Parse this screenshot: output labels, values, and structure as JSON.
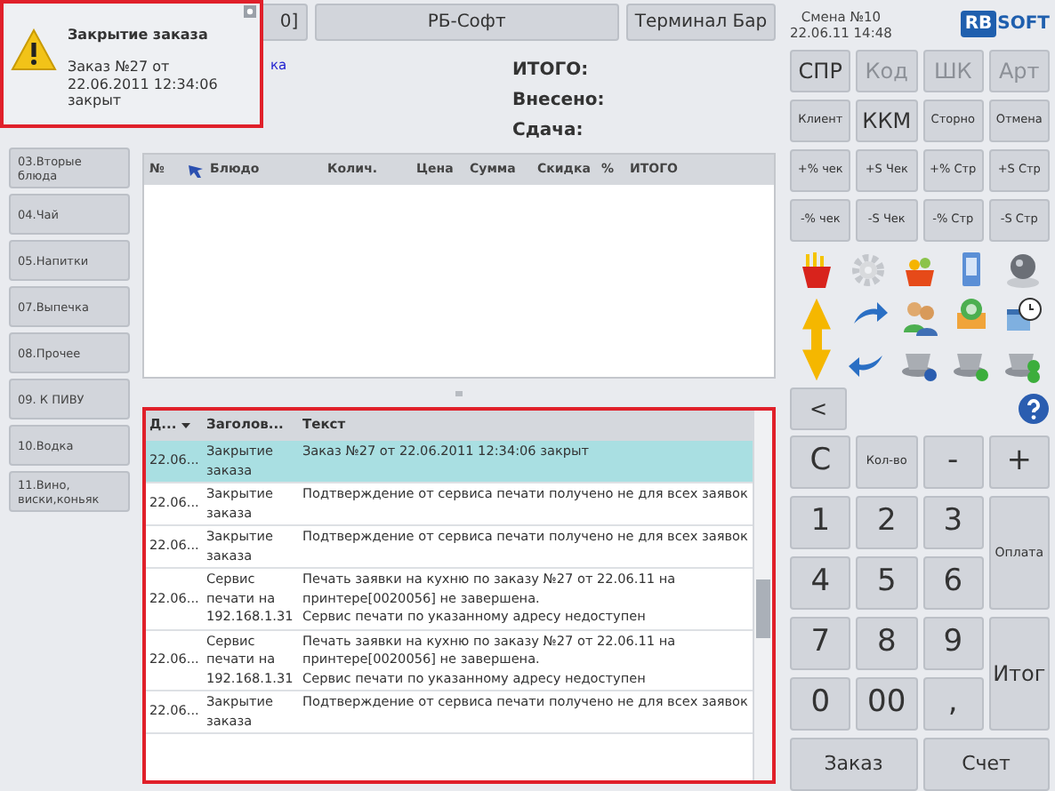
{
  "notification": {
    "title": "Закрытие заказа",
    "message": "Заказ №27 от 22.06.2011 12:34:06 закрыт"
  },
  "categories": [
    "03.Вторые блюда",
    "04.Чай",
    "05.Напитки",
    "07.Выпечка",
    "08.Прочее",
    "09. К ПИВУ",
    "10.Водка",
    "11.Вино, виски,коньяк"
  ],
  "top_buttons": [
    "0]",
    "РБ-Софт",
    "Терминал Бар"
  ],
  "link": "ка",
  "totals": [
    "ИТОГО:",
    "Внесено:",
    "Сдача:"
  ],
  "order_table": {
    "columns": [
      "№",
      "Блюдо",
      "Колич.",
      "Цена",
      "Сумма",
      "Скидка",
      "%",
      "ИТОГО"
    ]
  },
  "log": {
    "columns": [
      "Д...",
      "Заголов...",
      "Текст"
    ],
    "rows": [
      {
        "date": "22.06...",
        "title": "Закрытие заказа",
        "text": "Заказ №27 от 22.06.2011 12:34:06 закрыт",
        "selected": true
      },
      {
        "date": "22.06...",
        "title": "Закрытие заказа",
        "text": "Подтверждение от сервиса печати получено не для всех заявок",
        "selected": false
      },
      {
        "date": "22.06...",
        "title": "Закрытие заказа",
        "text": "Подтверждение от сервиса печати получено не для всех заявок",
        "selected": false
      },
      {
        "date": "22.06...",
        "title": "Сервис печати на 192.168.1.31",
        "text": "Печать заявки на кухню по заказу №27 от 22.06.11 на\nпринтере[0020056] не завершена.\nСервис печати по указанному адресу недоступен",
        "selected": false
      },
      {
        "date": "22.06...",
        "title": "Сервис печати на 192.168.1.31",
        "text": "Печать заявки на кухню по заказу №27 от 22.06.11 на\nпринтере[0020056] не завершена.\nСервис печати по указанному адресу недоступен",
        "selected": false
      },
      {
        "date": "22.06...",
        "title": "Закрытие заказа",
        "text": "Подтверждение от сервиса печати получено не для всех заявок",
        "selected": false
      }
    ]
  },
  "shift": {
    "number": "Смена №10",
    "datetime": "22.06.11 14:48"
  },
  "logo": {
    "boxed": "RB",
    "plain": "SOFT"
  },
  "function_buttons": [
    {
      "label": "СПР",
      "kind": "large",
      "disabled": false
    },
    {
      "label": "Код",
      "kind": "large",
      "disabled": true
    },
    {
      "label": "ШК",
      "kind": "large",
      "disabled": true
    },
    {
      "label": "Арт",
      "kind": "large",
      "disabled": true
    },
    {
      "label": "Клиент",
      "kind": "small",
      "disabled": false
    },
    {
      "label": "ККМ",
      "kind": "large",
      "disabled": false
    },
    {
      "label": "Сторно",
      "kind": "small",
      "disabled": false
    },
    {
      "label": "Отмена",
      "kind": "small",
      "disabled": false
    },
    {
      "label": "+% чек",
      "kind": "small",
      "disabled": false
    },
    {
      "label": "+S Чек",
      "kind": "small",
      "disabled": false
    },
    {
      "label": "+% Стр",
      "kind": "small",
      "disabled": false
    },
    {
      "label": "+S Стр",
      "kind": "small",
      "disabled": false
    },
    {
      "label": "-% чек",
      "kind": "small",
      "disabled": false
    },
    {
      "label": "-S Чек",
      "kind": "small",
      "disabled": false
    },
    {
      "label": "-% Стр",
      "kind": "small",
      "disabled": false
    },
    {
      "label": "-S Стр",
      "kind": "small",
      "disabled": false
    }
  ],
  "back_button": "<",
  "keypad": [
    {
      "label": "C",
      "kind": "digit"
    },
    {
      "label": "Кол-во",
      "kind": "small"
    },
    {
      "label": "-",
      "kind": "digit"
    },
    {
      "label": "+",
      "kind": "digit"
    },
    {
      "label": "1",
      "kind": "digit"
    },
    {
      "label": "2",
      "kind": "digit"
    },
    {
      "label": "3",
      "kind": "digit"
    },
    {
      "label": "Оплата",
      "kind": "tall-small"
    },
    {
      "label": "4",
      "kind": "digit"
    },
    {
      "label": "5",
      "kind": "digit"
    },
    {
      "label": "6",
      "kind": "digit"
    },
    {
      "label": "7",
      "kind": "digit"
    },
    {
      "label": "8",
      "kind": "digit"
    },
    {
      "label": "9",
      "kind": "digit"
    },
    {
      "label": "Итог",
      "kind": "tall"
    },
    {
      "label": "0",
      "kind": "digit"
    },
    {
      "label": "00",
      "kind": "digit"
    },
    {
      "label": ",",
      "kind": "digit"
    },
    {
      "label": "Заказ",
      "kind": "wide"
    },
    {
      "label": "Счет",
      "kind": "wide"
    }
  ]
}
